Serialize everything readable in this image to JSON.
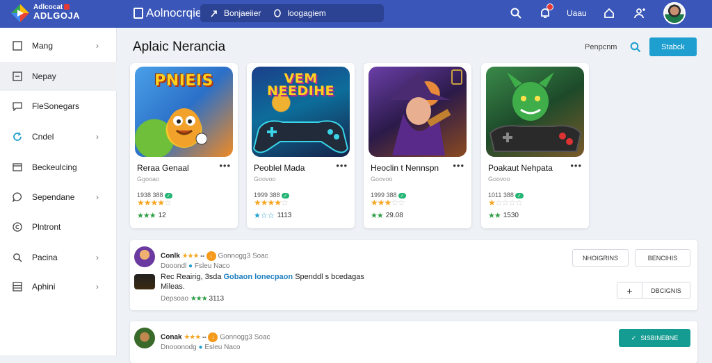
{
  "brand": {
    "line1": "Adlcocat",
    "line2": "ADLGOJA"
  },
  "header": {
    "title": "Aolnocrqiel",
    "search_seg1": "Bonjaeiier",
    "search_seg2": "loogagiem",
    "user_text": "Uaau"
  },
  "sidebar": {
    "items": [
      {
        "label": "Mang",
        "icon": "square-icon"
      },
      {
        "label": "Nepay",
        "icon": "minus-square-icon"
      },
      {
        "label": "FleSonegars",
        "icon": "chat-icon"
      },
      {
        "label": "Cndel",
        "icon": "refresh-icon"
      },
      {
        "label": "Beckeulcing",
        "icon": "window-icon"
      },
      {
        "label": "Sependane",
        "icon": "speech-bubble-icon"
      },
      {
        "label": "Plntront",
        "icon": "circle-c-icon"
      },
      {
        "label": "Pacina",
        "icon": "search-icon"
      },
      {
        "label": "Aphini",
        "icon": "grid-icon"
      }
    ]
  },
  "main": {
    "title": "Aplaic Nerancia",
    "header_link": "Penpcnm",
    "header_button": "Stabck"
  },
  "cards": [
    {
      "art_text": "PNIEIS",
      "name": "Reraa Genaal",
      "sub": "Ggooao",
      "stats": "1938 388",
      "bottom": "12"
    },
    {
      "art_text": "VEM NEEDIHE",
      "name": "Peoblel Mada",
      "sub": "Goovoo",
      "stats": "1999 388",
      "bottom": "1113"
    },
    {
      "art_text": "",
      "name": "Heoclin t Nennspn",
      "sub": "Goovoo",
      "stats": "1999 388",
      "bottom": "29.08"
    },
    {
      "art_text": "",
      "name": "Poakaut Nehpata",
      "sub": "Goovoo",
      "stats": "1011 388",
      "bottom": "1530"
    }
  ],
  "list": [
    {
      "name": "Conlk",
      "meta": "Gonnogg3 Soac",
      "sub1": "Dooondl",
      "sub2": "Fsleu Naco",
      "desc_a": "Rec Reairig, 3sda",
      "desc_link": "Gobaon lonecpaon",
      "desc_b": "Spenddl s bcedagas",
      "desc_line2": "Mileas.",
      "foot": "Depsoao",
      "foot_num": "3113",
      "btn1": "NHOIGRINS",
      "btn2": "BENCIHIS",
      "btn_plus": "+",
      "btn3": "DBCIGNIS"
    },
    {
      "name": "Conak",
      "meta": "Gonnogg3 Soac",
      "sub1": "Dnooonodg",
      "sub2": "Esleu Naco",
      "btn": "SISBINEBNE"
    }
  ]
}
